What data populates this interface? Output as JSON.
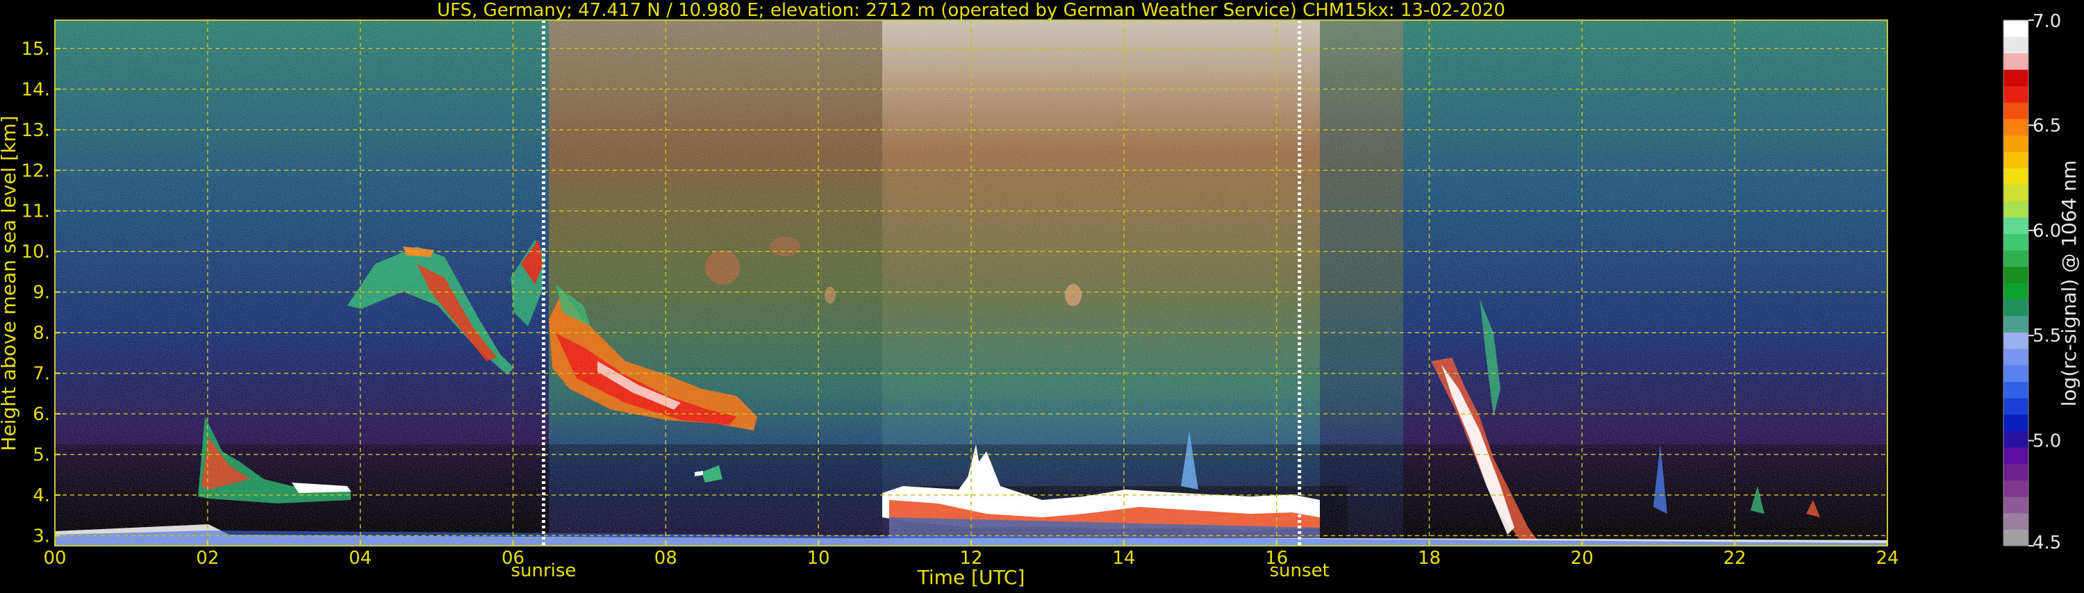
{
  "chart_data": {
    "type": "heatmap",
    "title": "UFS, Germany; 47.417 N / 10.980 E; elevation: 2712 m  (operated by German Weather Service)    CHM15kx: 13-02-2020",
    "xlabel": "Time [UTC]",
    "ylabel": "Height above mean sea level [km]",
    "xlim": [
      0,
      24
    ],
    "ylim": [
      2.75,
      15.7
    ],
    "x_ticks": [
      "00",
      "02",
      "04",
      "06",
      "08",
      "10",
      "12",
      "14",
      "16",
      "18",
      "20",
      "22",
      "24"
    ],
    "y_ticks": [
      "3.",
      "4.",
      "5.",
      "6.",
      "7.",
      "8.",
      "9.",
      "10.",
      "11.",
      "12.",
      "13.",
      "14.",
      "15."
    ],
    "grid": true,
    "markers": [
      {
        "label": "sunrise",
        "x": 6.4
      },
      {
        "label": "sunset",
        "x": 16.3
      }
    ],
    "colorbar": {
      "label": "log(rc-signal) @ 1064 nm",
      "range": [
        4.5,
        7.0
      ],
      "ticks": [
        "4.5",
        "5.0",
        "5.5",
        "6.0",
        "6.5",
        "7.0"
      ],
      "colors": [
        "#a0a0a0",
        "#9a7fa0",
        "#8f5a98",
        "#82378e",
        "#6f1f8f",
        "#5a0fa0",
        "#2810a0",
        "#0a1ec0",
        "#1a40d8",
        "#2f60e8",
        "#5a82ee",
        "#7a95f0",
        "#9ab0f0",
        "#4aa090",
        "#209060",
        "#10a030",
        "#189020",
        "#30b050",
        "#40c870",
        "#60d890",
        "#a8e050",
        "#d0e030",
        "#f0e010",
        "#f8c000",
        "#f8a000",
        "#f88010",
        "#f05010",
        "#e82010",
        "#d00808",
        "#f0b0b0",
        "#e8e8e8",
        "#ffffff"
      ]
    },
    "features": [
      {
        "kind": "cloud",
        "x": [
          1.8,
          3.8
        ],
        "y": [
          4.1,
          5.8
        ]
      },
      {
        "kind": "cloud",
        "x": [
          3.8,
          6.3
        ],
        "y": [
          7.1,
          10.2
        ]
      },
      {
        "kind": "cloud",
        "x": [
          6.4,
          8.2
        ],
        "y": [
          5.6,
          8.4
        ]
      },
      {
        "kind": "cloud",
        "x": [
          10.8,
          16.4
        ],
        "y": [
          3.3,
          5.2
        ]
      },
      {
        "kind": "cloud",
        "x": [
          17.8,
          19.5
        ],
        "y": [
          2.9,
          8.5
        ]
      },
      {
        "kind": "low-layer",
        "x": [
          0,
          24
        ],
        "y": [
          2.8,
          3.2
        ]
      }
    ]
  }
}
